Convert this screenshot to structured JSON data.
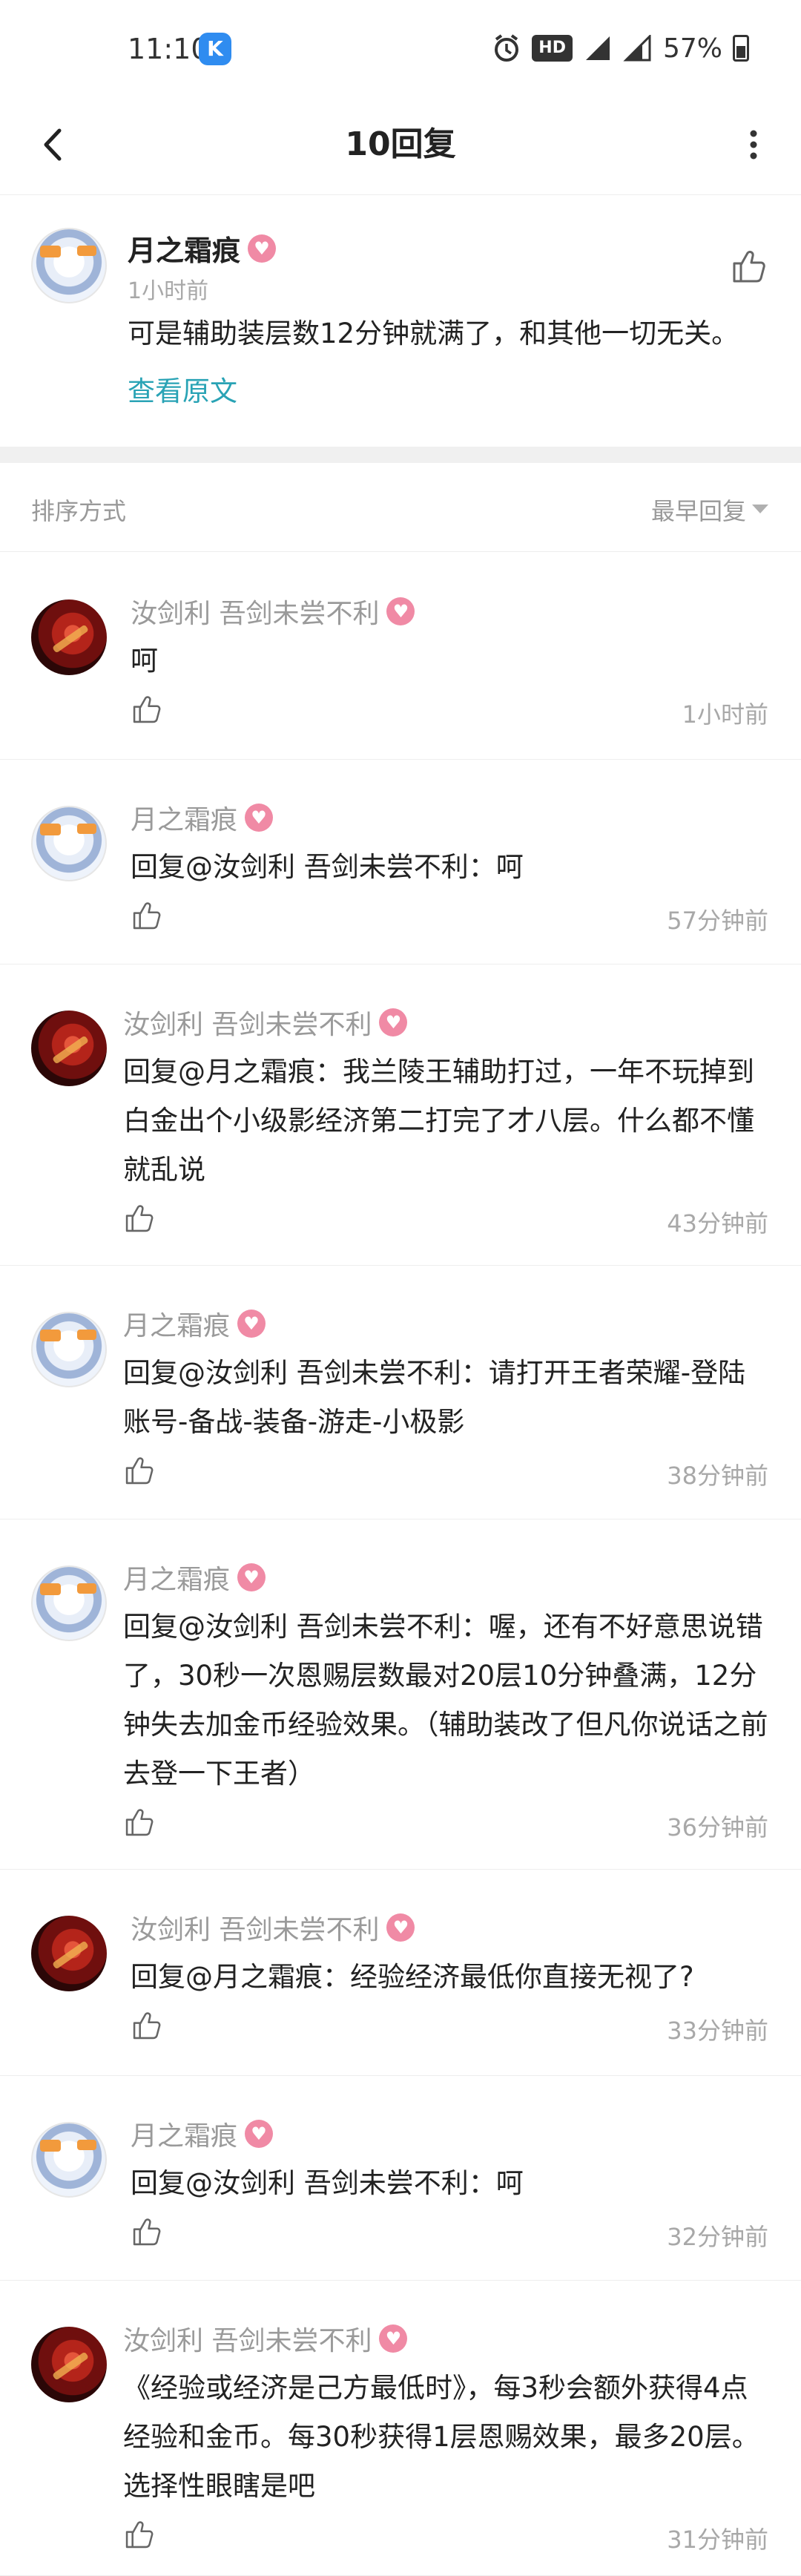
{
  "status": {
    "time": "11:10",
    "app_icon": "K",
    "hd": "HD",
    "battery": "57%"
  },
  "nav": {
    "title": "10回复",
    "back_icon": "chevron-left-icon",
    "more_icon": "more-vertical-icon"
  },
  "original": {
    "author": "月之霜痕",
    "time": "1小时前",
    "text": "可是辅助装层数12分钟就满了，和其他一切无关。",
    "link": "查看原文"
  },
  "sort": {
    "label": "排序方式",
    "value": "最早回复"
  },
  "replies": [
    {
      "author": "汝剑利 吾剑未尝不利",
      "text": "呵",
      "time": "1小时前",
      "avatar": "sword"
    },
    {
      "author": "月之霜痕",
      "text": "回复@汝剑利 吾剑未尝不利：呵",
      "time": "57分钟前",
      "avatar": "mika"
    },
    {
      "author": "汝剑利 吾剑未尝不利",
      "text": "回复@月之霜痕：我兰陵王辅助打过，一年不玩掉到白金出个小级影经济第二打完了才八层。什么都不懂就乱说",
      "time": "43分钟前",
      "avatar": "sword"
    },
    {
      "author": "月之霜痕",
      "text": "回复@汝剑利 吾剑未尝不利：请打开王者荣耀-登陆账号-备战-装备-游走-小极影",
      "time": "38分钟前",
      "avatar": "mika"
    },
    {
      "author": "月之霜痕",
      "text": "回复@汝剑利 吾剑未尝不利：喔，还有不好意思说错了，30秒一次恩赐层数最对20层10分钟叠满，12分钟失去加金币经验效果。（辅助装改了但凡你说话之前去登一下王者）",
      "time": "36分钟前",
      "avatar": "mika"
    },
    {
      "author": "汝剑利 吾剑未尝不利",
      "text": "回复@月之霜痕：经验经济最低你直接无视了?",
      "time": "33分钟前",
      "avatar": "sword"
    },
    {
      "author": "月之霜痕",
      "text": "回复@汝剑利 吾剑未尝不利：呵",
      "time": "32分钟前",
      "avatar": "mika"
    },
    {
      "author": "汝剑利 吾剑未尝不利",
      "text": "《经验或经济是己方最低时》，每3秒会额外获得4点经验和金币。每30秒获得1层恩赐效果，最多20层。选择性眼瞎是吧",
      "time": "31分钟前",
      "avatar": "sword"
    }
  ],
  "badge_glyph": "♥"
}
